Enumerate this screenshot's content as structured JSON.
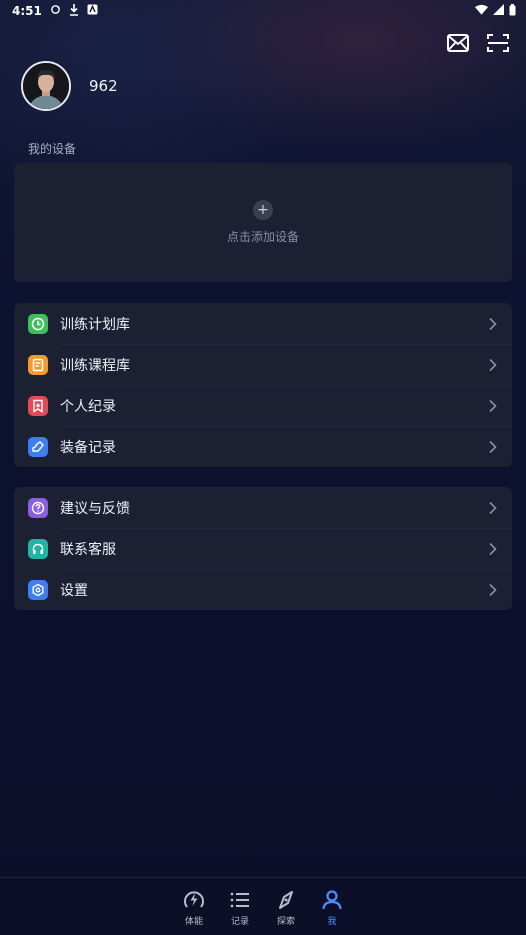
{
  "status_bar": {
    "time": "4:51"
  },
  "profile": {
    "username": "962"
  },
  "devices": {
    "section_label": "我的设备",
    "add_label": "点击添加设备"
  },
  "menu_group_1": [
    {
      "label": "训练计划库",
      "icon": "clock-icon",
      "color": "#3fbf5a"
    },
    {
      "label": "训练课程库",
      "icon": "document-icon",
      "color": "#f39a2e"
    },
    {
      "label": "个人纪录",
      "icon": "bookmark-star-icon",
      "color": "#e24b55"
    },
    {
      "label": "装备记录",
      "icon": "shoe-icon",
      "color": "#3f7ef0"
    }
  ],
  "menu_group_2": [
    {
      "label": "建议与反馈",
      "icon": "question-icon",
      "color": "#8a5fe0"
    },
    {
      "label": "联系客服",
      "icon": "headset-icon",
      "color": "#21b3a6"
    },
    {
      "label": "设置",
      "icon": "hexagon-settings-icon",
      "color": "#3f7ef0"
    }
  ],
  "tabbar": {
    "tabs": [
      {
        "label": "体能",
        "icon": "lightning-gauge-icon"
      },
      {
        "label": "记录",
        "icon": "list-icon"
      },
      {
        "label": "探索",
        "icon": "compass-icon"
      },
      {
        "label": "我",
        "icon": "person-icon"
      }
    ],
    "active": "我",
    "active_color": "#4d8dff"
  }
}
